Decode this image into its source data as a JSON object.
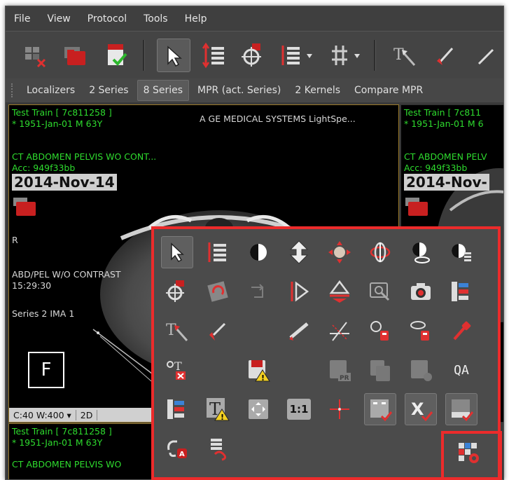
{
  "menu": [
    "File",
    "View",
    "Protocol",
    "Tools",
    "Help"
  ],
  "series_bar": {
    "items": [
      "Localizers",
      "2 Series",
      "8 Series",
      "MPR (act. Series)",
      "2 Kernels",
      "Compare MPR"
    ],
    "selected_index": 2
  },
  "main_viewport": {
    "patient": "Test Train [ 7c811258 ]",
    "dob": "* 1951-Jan-01 M 63Y",
    "manufacturer": "A  GE MEDICAL SYSTEMS LightSpe...",
    "study": "CT ABDOMEN PELVIS WO CONT...",
    "acc": "Acc: 949f33bb",
    "date": "2014-Nov-14",
    "side_marker": "R",
    "series_desc": "ABD/PEL W/O CONTRAST",
    "time": "15:29:30",
    "series_ima": "Series 2 IMA 1",
    "orientation": "F",
    "window_level": "C:40 W:400",
    "mode": "2D"
  },
  "right_viewport": {
    "patient": "Test Train [ 7c811",
    "dob": "* 1951-Jan-01 M 6",
    "study": "CT ABDOMEN PELV",
    "acc": "Acc: 949f33bb",
    "date": "2014-Nov-"
  },
  "bottom_viewport": {
    "patient": "Test Train [ 7c811258 ]",
    "dob": "* 1951-Jan-01 M 63Y",
    "study": "CT ABDOMEN PELVIS WO"
  },
  "palette": {
    "scale_1_1": "1:1",
    "qa": "QA",
    "text_tool": "T",
    "pr_tag": "PR"
  },
  "colors": {
    "overlay_text": "#2edb2e",
    "highlight": "#ec2b2b",
    "accent_red": "#d42a2a",
    "accent_blue": "#3b82d6"
  }
}
